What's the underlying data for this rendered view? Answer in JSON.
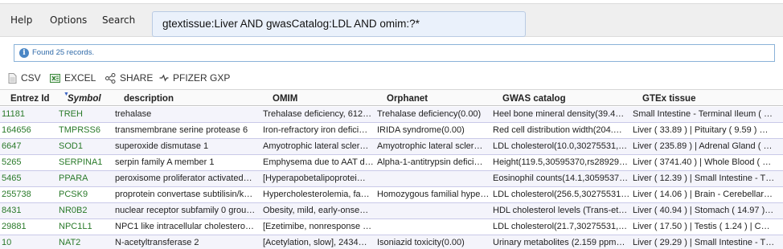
{
  "nav": {
    "help": "Help",
    "options": "Options",
    "search": "Search"
  },
  "search": {
    "query": "gtextissue:Liver AND gwasCatalog:LDL AND omim:?*"
  },
  "status": {
    "info_icon": "i",
    "message": "Found 25 records."
  },
  "exports": {
    "csv": "CSV",
    "excel": "EXCEL",
    "share": "SHARE",
    "pfizer": "PFIZER GXP"
  },
  "table": {
    "columns": [
      "Entrez Id",
      "Symbol",
      "description",
      "OMIM",
      "Orphanet",
      "GWAS catalog",
      "GTEx tissue"
    ],
    "sort_indicator": "▼",
    "rows": [
      [
        "11181",
        "TREH",
        "trehalase",
        "Trehalase deficiency, 612…",
        "Trehalase deficiency(0.00)",
        "Heel bone mineral density(39.4…",
        "Small Intestine - Terminal Ileum ( …"
      ],
      [
        "164656",
        "TMPRSS6",
        "transmembrane serine protease 6",
        "Iron-refractory iron defici…",
        "IRIDA syndrome(0.00)",
        "Red cell distribution width(204.…",
        "Liver ( 33.89 ) | Pituitary ( 9.59 ) …"
      ],
      [
        "6647",
        "SOD1",
        "superoxide dismutase 1",
        "Amyotrophic lateral scler…",
        "Amyotrophic lateral scler…",
        "LDL cholesterol(10.0,30275531,…",
        "Liver ( 235.89 ) | Adrenal Gland ( …"
      ],
      [
        "5265",
        "SERPINA1",
        "serpin family A member 1",
        "Emphysema due to AAT d…",
        "Alpha-1-antitrypsin defici…",
        "Height(119.5,30595370,rs28929…",
        "Liver ( 3741.40 ) | Whole Blood ( …"
      ],
      [
        "5465",
        "PPARA",
        "peroxisome proliferator activated…",
        "[Hyperapobetalipoprotei…",
        "",
        "Eosinophil counts(14.1,3059537…",
        "Liver ( 12.39 ) | Small Intestine - T…"
      ],
      [
        "255738",
        "PCSK9",
        "proprotein convertase subtilisin/k…",
        "Hypercholesterolemia, fa…",
        "Homozygous familial hype…",
        "LDL cholesterol(256.5,30275531…",
        "Liver ( 14.06 ) | Brain - Cerebellar…"
      ],
      [
        "8431",
        "NR0B2",
        "nuclear receptor subfamily 0 grou…",
        "Obesity, mild, early-onse…",
        "",
        "HDL cholesterol levels (Trans-et…",
        "Liver ( 40.94 ) | Stomach ( 14.97 )…"
      ],
      [
        "29881",
        "NPC1L1",
        "NPC1 like intracellular cholestero…",
        "[Ezetimibe, nonresponse …",
        "",
        "LDL cholesterol(21.7,30275531,…",
        "Liver ( 17.50 ) | Testis ( 1.24 ) | C…"
      ],
      [
        "10",
        "NAT2",
        "N-acetyltransferase 2",
        "[Acetylation, slow], 2434…",
        "Isoniazid toxicity(0.00)",
        "Urinary metabolites (2.159 ppm…",
        "Liver ( 29.29 ) | Small Intestine - T…"
      ]
    ]
  },
  "colors": {
    "link": "#2a7a2a",
    "info": "#2f6aa8",
    "row_border": "#c9c9e8"
  }
}
